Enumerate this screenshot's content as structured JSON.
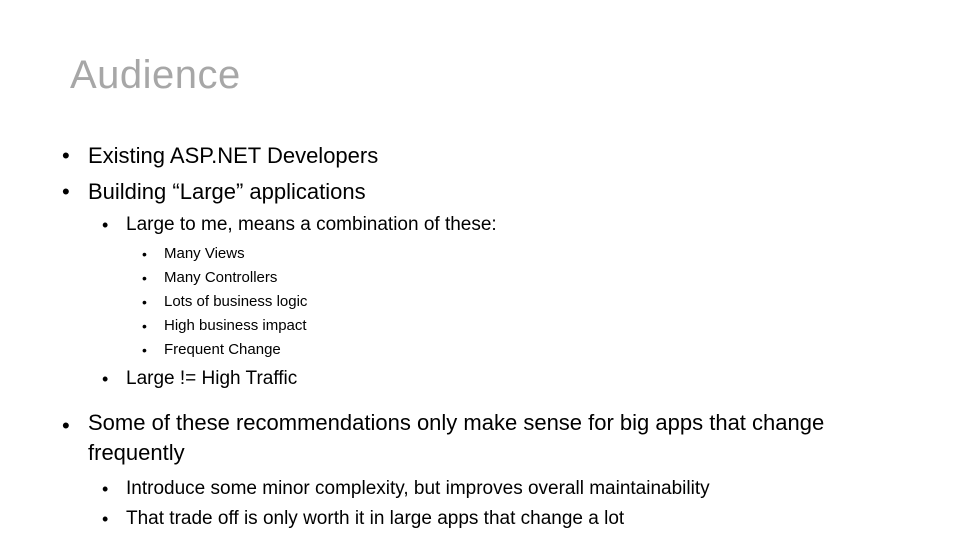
{
  "slide": {
    "title": "Audience",
    "title_color": "#a7a7a7",
    "background_color": "#ffffff",
    "bullet_glyph": "•",
    "content": [
      {
        "level": 1,
        "text": "Existing ASP.NET Developers"
      },
      {
        "level": 1,
        "text": "Building “Large” applications"
      },
      {
        "level": 2,
        "text": "Large to me, means a combination of these:"
      },
      {
        "level": 3,
        "text": "Many Views"
      },
      {
        "level": 3,
        "text": "Many Controllers"
      },
      {
        "level": 3,
        "text": "Lots of business logic"
      },
      {
        "level": 3,
        "text": "High business impact"
      },
      {
        "level": 3,
        "text": "Frequent Change"
      },
      {
        "level": 2,
        "text": "Large != High Traffic"
      },
      {
        "level": 1,
        "text": "Some of these recommendations only make sense for big apps that change frequently"
      },
      {
        "level": 2,
        "text": "Introduce some minor complexity, but improves overall maintainability"
      },
      {
        "level": 2,
        "text": "That trade off is only worth it in large apps that change a lot"
      }
    ]
  }
}
